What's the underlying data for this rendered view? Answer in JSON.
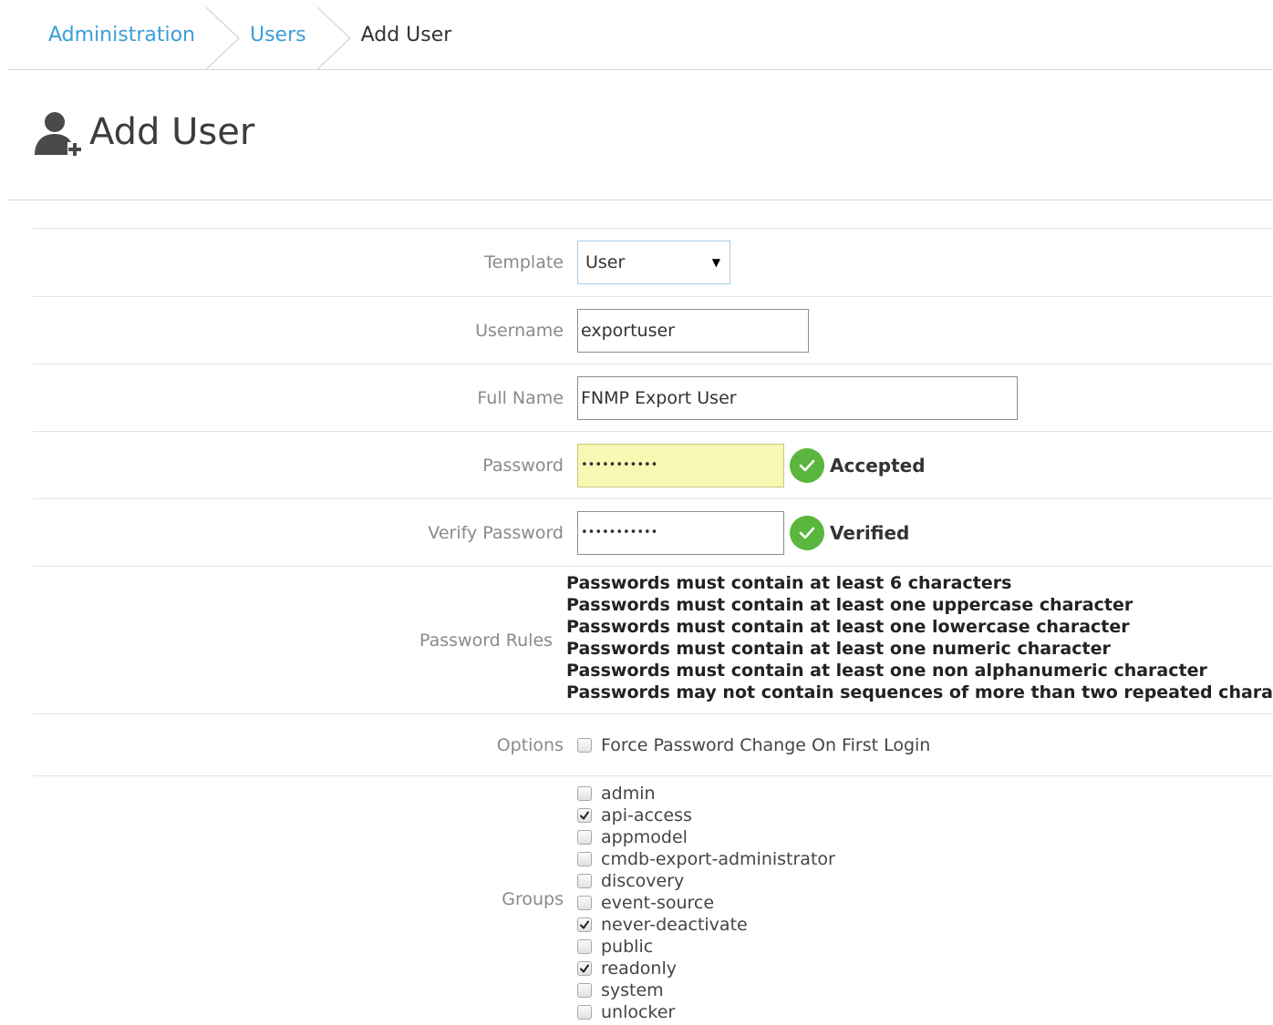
{
  "breadcrumb": {
    "items": [
      {
        "label": "Administration"
      },
      {
        "label": "Users"
      },
      {
        "label": "Add User"
      }
    ]
  },
  "page": {
    "title": "Add User",
    "icon": "add-user-icon"
  },
  "form": {
    "template": {
      "label": "Template",
      "value": "User"
    },
    "username": {
      "label": "Username",
      "value": "exportuser"
    },
    "full_name": {
      "label": "Full Name",
      "value": "FNMP Export User"
    },
    "password": {
      "label": "Password",
      "value": "•••••••••••",
      "status": "Accepted"
    },
    "verify_password": {
      "label": "Verify Password",
      "value": "•••••••••••",
      "status": "Verified"
    },
    "password_rules": {
      "label": "Password Rules",
      "rules": [
        "Passwords must contain at least 6 characters",
        "Passwords must contain at least one uppercase character",
        "Passwords must contain at least one lowercase character",
        "Passwords must contain at least one numeric character",
        "Passwords must contain at least one non alphanumeric character",
        "Passwords may not contain sequences of more than two repeated chara"
      ]
    },
    "options": {
      "label": "Options",
      "items": [
        {
          "label": "Force Password Change On First Login",
          "checked": false
        }
      ]
    },
    "groups": {
      "label": "Groups",
      "items": [
        {
          "label": "admin",
          "checked": false
        },
        {
          "label": "api-access",
          "checked": true
        },
        {
          "label": "appmodel",
          "checked": false
        },
        {
          "label": "cmdb-export-administrator",
          "checked": false
        },
        {
          "label": "discovery",
          "checked": false
        },
        {
          "label": "event-source",
          "checked": false
        },
        {
          "label": "never-deactivate",
          "checked": true
        },
        {
          "label": "public",
          "checked": false
        },
        {
          "label": "readonly",
          "checked": true
        },
        {
          "label": "system",
          "checked": false
        },
        {
          "label": "unlocker",
          "checked": false
        }
      ]
    }
  },
  "colors": {
    "link": "#3a9fd8",
    "success": "#5ab63e",
    "password_highlight": "#f7f8b4"
  }
}
